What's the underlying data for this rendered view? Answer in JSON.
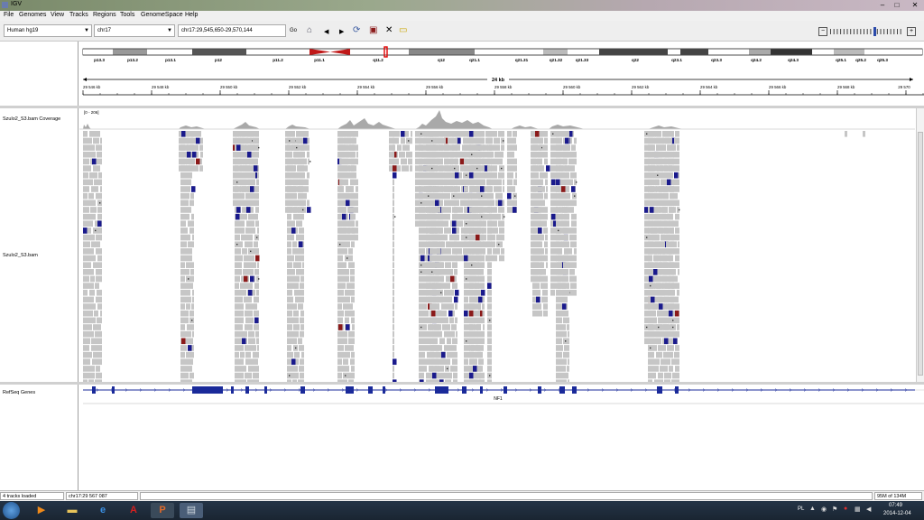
{
  "window": {
    "title": "IGV"
  },
  "menu": [
    "File",
    "Genomes",
    "View",
    "Tracks",
    "Regions",
    "Tools",
    "GenomeSpace",
    "Help"
  ],
  "toolbar": {
    "genome": "Human hg19",
    "chromosome": "chr17",
    "locus": "chr17:29,545,650-29,570,144",
    "go_label": "Go"
  },
  "ideogram": {
    "bands": [
      "p13.3",
      "p13.2",
      "p13.1",
      "p12",
      "p11.2",
      "p11.1",
      "q11.2",
      "q12",
      "q21.1",
      "q21.31",
      "q21.32",
      "q21.33",
      "q22",
      "q23.1",
      "q23.3",
      "q24.2",
      "q24.3",
      "q25.1",
      "q25.2",
      "q25.3"
    ]
  },
  "ruler": {
    "span_label": "24 kb",
    "ticks": [
      "29 546 kb",
      "29 548 kb",
      "29 550 kb",
      "29 552 kb",
      "29 554 kb",
      "29 556 kb",
      "29 558 kb",
      "29 560 kb",
      "29 562 kb",
      "29 564 kb",
      "29 566 kb",
      "29 568 kb",
      "29 570"
    ]
  },
  "tracks": {
    "coverage_name": "Szulo2_S3.bam Coverage",
    "coverage_range": "[0 - 206]",
    "alignment_name": "Szulo2_S3.bam",
    "genes_name": "RefSeq Genes",
    "gene_label": "NF1"
  },
  "colors": {
    "read": "#c6c6c6",
    "mismatch_blue": "#1a1a8c",
    "mismatch_red": "#8b1a1a",
    "gene": "#1a2a9a"
  },
  "status": {
    "tracks_loaded": "4 tracks loaded",
    "position": "chr17:29 567 087",
    "memory": "95M of 134M"
  },
  "taskbar": {
    "lang": "PL",
    "time": "07:49",
    "date": "2014-12-04"
  }
}
